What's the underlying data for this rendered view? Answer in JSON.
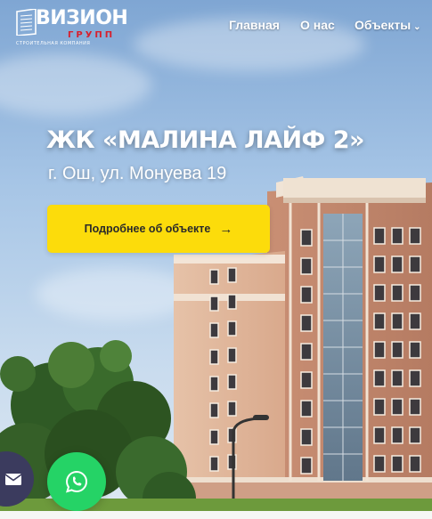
{
  "brand": {
    "name": "ВИЗИОН",
    "sub": "ГРУПП",
    "tagline": "СТРОИТЕЛЬНАЯ КОМПАНИЯ",
    "accent_red": "#d71f2d"
  },
  "nav": {
    "items": [
      {
        "label": "Главная"
      },
      {
        "label": "О нас"
      },
      {
        "label": "Объекты",
        "icon": "chevron-down-icon"
      }
    ]
  },
  "hero": {
    "title": "ЖК «МАЛИНА ЛАЙФ 2»",
    "address": "г. Ош, ул. Монуева 19",
    "cta_label": "Подробнее об объекте",
    "cta_icon": "arrow-right-icon",
    "cta_color": "#fcdc0b"
  },
  "floating": {
    "mail_icon": "envelope-icon",
    "whatsapp_icon": "whatsapp-icon",
    "whatsapp_color": "#25d366"
  }
}
